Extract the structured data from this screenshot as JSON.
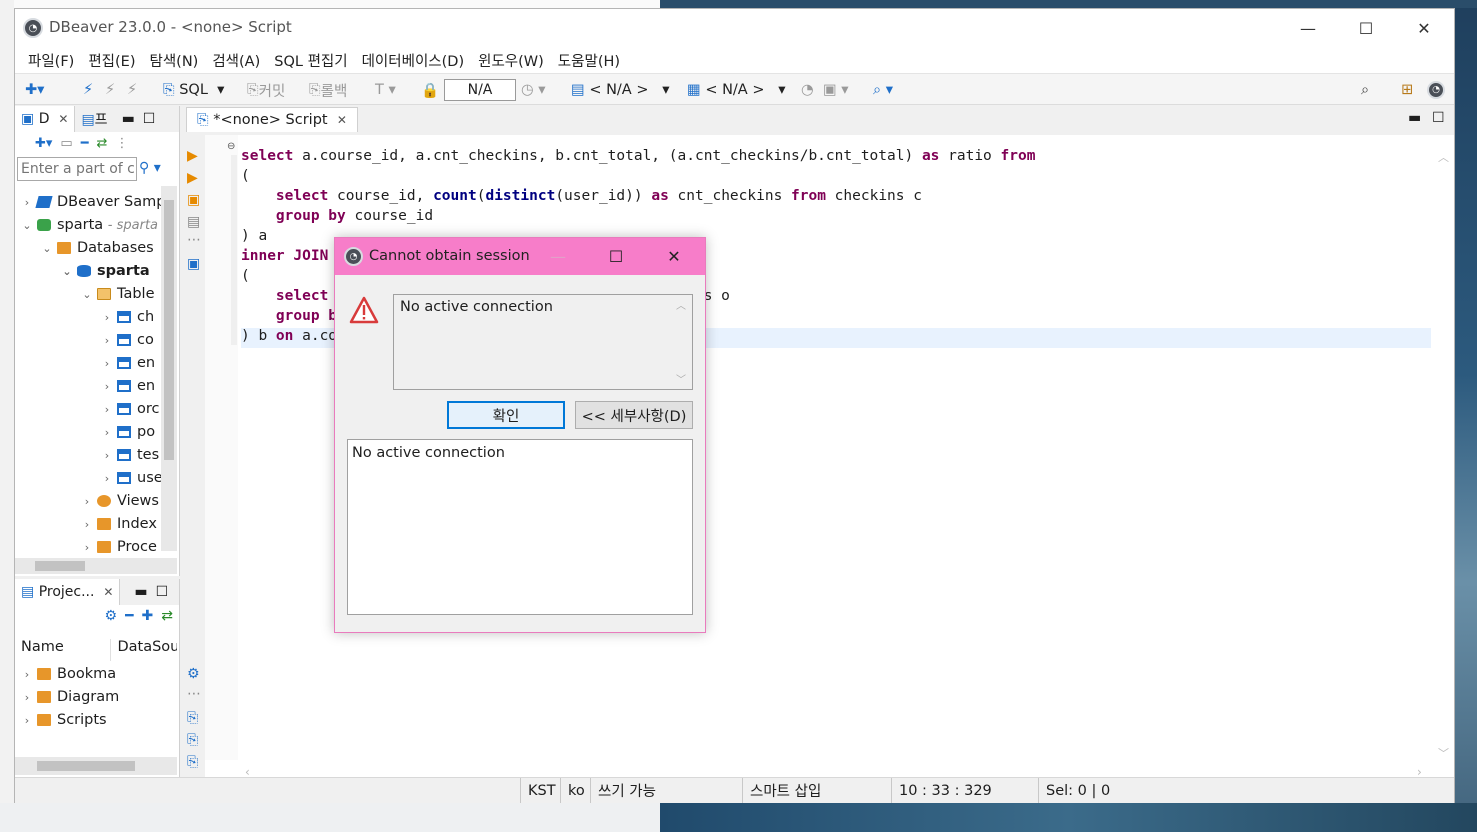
{
  "window": {
    "title": "DBeaver 23.0.0 - <none> Script",
    "minimize": "—",
    "maximize": "☐",
    "close": "✕"
  },
  "menu": [
    "파일(F)",
    "편집(E)",
    "탐색(N)",
    "검색(A)",
    "SQL 편집기",
    "데이터베이스(D)",
    "윈도우(W)",
    "도움말(H)"
  ],
  "toolbar": {
    "sql_label": "SQL",
    "commit_label": "커밋",
    "rollback_label": "롤백",
    "transaction_mode": "N/A",
    "datasource_selector": "< N/A >",
    "schema_selector": "< N/A >"
  },
  "navigator": {
    "tab_label": "D",
    "tab2_label": "프",
    "filter_placeholder": "Enter a part of c",
    "items": [
      {
        "label": "DBeaver Samp",
        "suffix": ""
      },
      {
        "label": "sparta",
        "suffix": "- sparta"
      },
      {
        "label": "Databases",
        "suffix": ""
      },
      {
        "label": "sparta",
        "suffix": ""
      },
      {
        "label": "Table",
        "suffix": ""
      },
      {
        "label": "ch",
        "suffix": ""
      },
      {
        "label": "co",
        "suffix": ""
      },
      {
        "label": "en",
        "suffix": ""
      },
      {
        "label": "en",
        "suffix": ""
      },
      {
        "label": "orc",
        "suffix": ""
      },
      {
        "label": "po",
        "suffix": ""
      },
      {
        "label": "tes",
        "suffix": ""
      },
      {
        "label": "use",
        "suffix": ""
      },
      {
        "label": "Views",
        "suffix": ""
      },
      {
        "label": "Index",
        "suffix": ""
      },
      {
        "label": "Proce",
        "suffix": ""
      }
    ]
  },
  "projects": {
    "tab_label": "Projec...",
    "col_name": "Name",
    "col_datasource": "DataSou",
    "items": [
      "Bookma",
      "Diagram",
      "Scripts"
    ]
  },
  "editor": {
    "tab_label": "*<none> Script",
    "lines": [
      {
        "parts": [
          [
            "kw",
            "select"
          ],
          [
            "t",
            " a.course_id, a.cnt_checkins, b.cnt_total, (a.cnt_checkins/b.cnt_total) "
          ],
          [
            "kw",
            "as"
          ],
          [
            "t",
            " ratio "
          ],
          [
            "kw",
            "from"
          ]
        ]
      },
      {
        "parts": [
          [
            "t",
            "("
          ]
        ]
      },
      {
        "parts": [
          [
            "t",
            "    "
          ],
          [
            "kw",
            "select"
          ],
          [
            "t",
            " course_id, "
          ],
          [
            "kwb",
            "count"
          ],
          [
            "t",
            "("
          ],
          [
            "kwb",
            "distinct"
          ],
          [
            "t",
            "(user_id)) "
          ],
          [
            "kw",
            "as"
          ],
          [
            "t",
            " cnt_checkins "
          ],
          [
            "kw",
            "from"
          ],
          [
            "t",
            " checkins c"
          ]
        ]
      },
      {
        "parts": [
          [
            "t",
            "    "
          ],
          [
            "kw",
            "group by"
          ],
          [
            "t",
            " course_id"
          ]
        ]
      },
      {
        "parts": [
          [
            "t",
            ") a"
          ]
        ]
      },
      {
        "parts": [
          [
            "kw",
            "inner JOIN"
          ]
        ]
      },
      {
        "parts": [
          [
            "t",
            "("
          ]
        ]
      },
      {
        "parts": [
          [
            "t",
            "    "
          ],
          [
            "kw",
            "select"
          ],
          [
            "t",
            "                                         ers o"
          ]
        ]
      },
      {
        "parts": [
          [
            "t",
            "    "
          ],
          [
            "kw",
            "group b"
          ]
        ]
      },
      {
        "parts": [
          [
            "t",
            ") b "
          ],
          [
            "kw",
            "on"
          ],
          [
            "t",
            " a.co"
          ]
        ]
      }
    ]
  },
  "status": {
    "timezone": "KST",
    "locale": "ko",
    "mode": "쓰기 가능",
    "insert_mode": "스마트 삽입",
    "position": "10 : 33 : 329",
    "selection": "Sel: 0 | 0"
  },
  "dialog": {
    "title": "Cannot obtain session",
    "message": "No active connection",
    "ok_label": "확인",
    "details_label": "<< 세부사항(D)",
    "details_text": "No active connection"
  }
}
